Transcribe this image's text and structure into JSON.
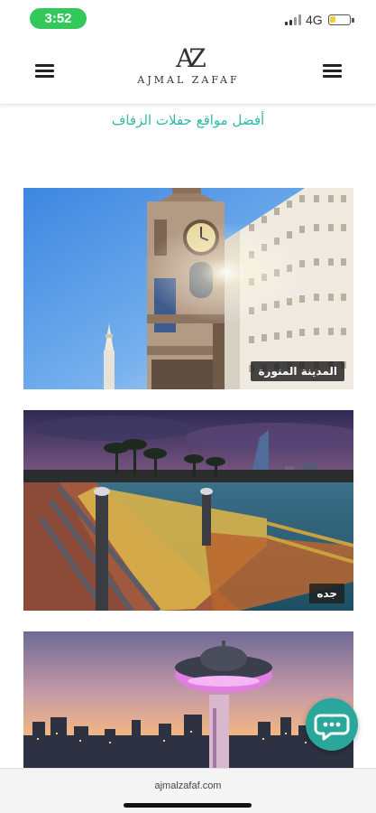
{
  "status_bar": {
    "time": "3:52",
    "network": "4G",
    "battery_icon": "battery-low-icon",
    "signal_icon": "signal-bars-icon"
  },
  "header": {
    "logo_mark": "AZ",
    "logo_text": "AJMAL ZAFAF",
    "left_menu_icon": "hamburger-menu-icon",
    "right_menu_icon": "hamburger-menu-icon"
  },
  "heading": "أفضل مواقع حفلات الزفاف",
  "cards": [
    {
      "label": "المدينة المنورة"
    },
    {
      "label": "جده"
    },
    {
      "label": ""
    }
  ],
  "chat": {
    "icon": "chat-bubble-icon"
  },
  "browser": {
    "url": "ajmalzafaf.com"
  },
  "colors": {
    "accent": "#2fb9a7",
    "fab": "#2aa79b",
    "time_pill": "#34c759"
  }
}
